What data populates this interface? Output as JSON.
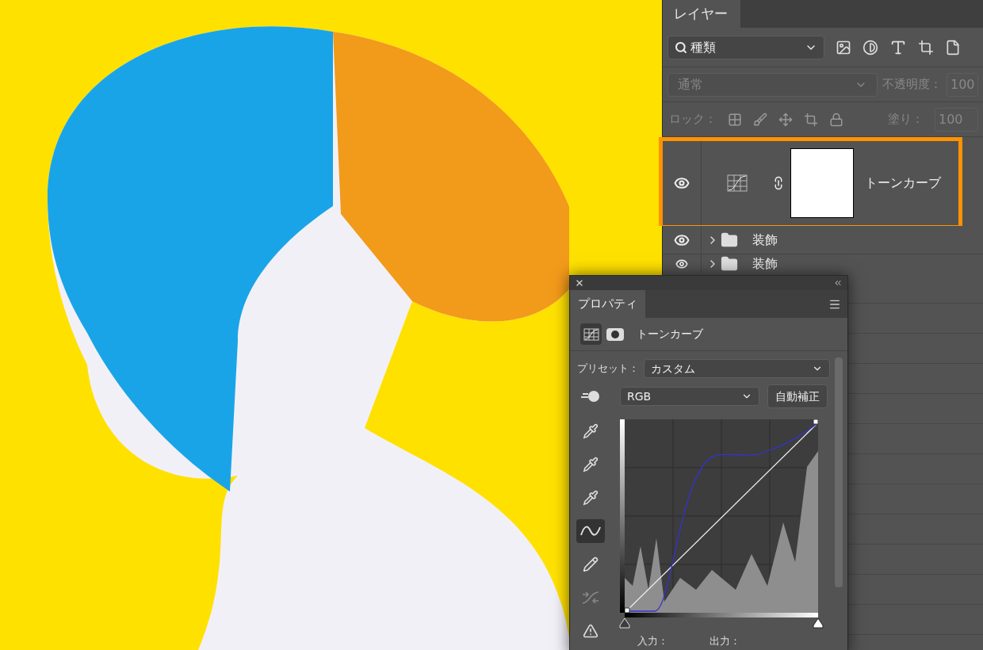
{
  "layers_panel": {
    "tab": "レイヤー",
    "filter": {
      "value": "種類"
    },
    "blend_mode": {
      "value": "通常",
      "disabled": true
    },
    "opacity": {
      "label": "不透明度：",
      "value": "100"
    },
    "lock": {
      "label": "ロック："
    },
    "fill": {
      "label": "塗り：",
      "value": "100"
    },
    "layers": [
      {
        "kind": "adjustment",
        "name": "トーンカーブ",
        "visible": true,
        "highlighted": true
      },
      {
        "kind": "group",
        "name": "装飾",
        "visible": true,
        "highlighted": false
      },
      {
        "kind": "group",
        "name": "装飾",
        "visible": true,
        "highlighted": false
      }
    ]
  },
  "properties_panel": {
    "tab": "プロパティ",
    "title": "トーンカーブ",
    "preset": {
      "label": "プリセット：",
      "value": "カスタム"
    },
    "channel": {
      "value": "RGB"
    },
    "auto_button": "自動補正",
    "tools": [
      {
        "kind": "eyedropper",
        "selected": false
      },
      {
        "kind": "eyedropper",
        "selected": false
      },
      {
        "kind": "eyedropper",
        "selected": false
      },
      {
        "kind": "curve",
        "selected": true
      },
      {
        "kind": "pencil",
        "selected": false
      },
      {
        "kind": "smooth",
        "selected": false
      },
      {
        "kind": "clipping",
        "selected": false
      }
    ],
    "input_sliders": [
      {
        "kind": "shadow",
        "level": 0
      },
      {
        "kind": "highlight",
        "level": 1
      }
    ],
    "input_label": "入力：",
    "output_label": "出力："
  }
}
